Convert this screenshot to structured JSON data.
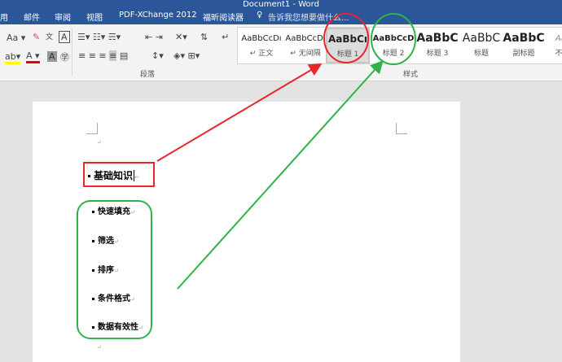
{
  "window": {
    "title": "Document1 - Word"
  },
  "tabs": [
    "用",
    "邮件",
    "审阅",
    "视图",
    "PDF-XChange 2012",
    "福昕阅读器"
  ],
  "tell_me": "告诉我您想要做什么...",
  "groups": {
    "paragraph": "段落",
    "styles": "样式"
  },
  "styles": [
    {
      "preview": "AaBbCcDı",
      "name": "↵ 正文"
    },
    {
      "preview": "AaBbCcDı",
      "name": "↵ 无间隔"
    },
    {
      "preview": "AaBbCı",
      "name": "标题 1"
    },
    {
      "preview": "AaBbCcD",
      "name": "标题 2"
    },
    {
      "preview": "AaBbC",
      "name": "标题 3"
    },
    {
      "preview": "AaBbC",
      "name": "标题"
    },
    {
      "preview": "AaBbC",
      "name": "副标题"
    },
    {
      "preview": "AaBb",
      "name": "不明显"
    }
  ],
  "document": {
    "heading": "基础知识",
    "items": [
      "快速填充",
      "筛选",
      "排序",
      "条件格式",
      "数据有效性"
    ],
    "para_mark": "↵"
  },
  "annotation_colors": {
    "red": "#e8262c",
    "green": "#2fb24a"
  }
}
